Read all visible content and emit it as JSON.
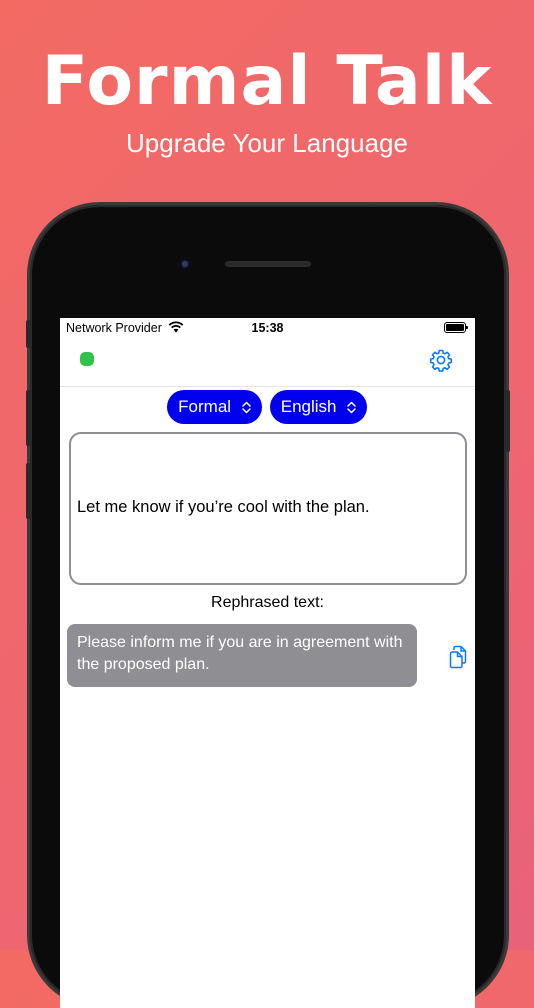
{
  "hero": {
    "title": "Formal Talk",
    "subtitle": "Upgrade Your Language"
  },
  "status_bar": {
    "provider": "Network Provider",
    "time": "15:38",
    "wifi_icon": "wifi-icon",
    "battery_icon": "battery-icon"
  },
  "nav": {
    "status_indicator_color": "#30c24a",
    "settings_icon": "gear-icon"
  },
  "selectors": {
    "tone": "Formal",
    "language": "English",
    "accent_color": "#0000ee"
  },
  "input": {
    "text": "Let me know if you’re cool with the plan."
  },
  "output": {
    "label": "Rephrased text:",
    "text": "Please inform me if you are in agreement with the proposed plan.",
    "copy_icon": "copy-icon"
  }
}
